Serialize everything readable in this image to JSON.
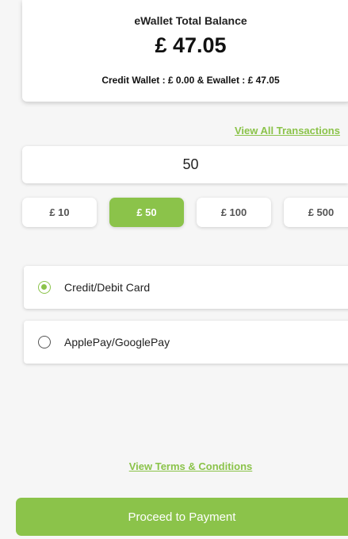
{
  "balance": {
    "title": "eWallet Total Balance",
    "amount": "£ 47.05",
    "breakdown": "Credit Wallet : £ 0.00 & Ewallet : £ 47.05"
  },
  "links": {
    "view_transactions": "View All Transactions",
    "terms": "View Terms & Conditions"
  },
  "amount_input": {
    "value": "50"
  },
  "presets": [
    {
      "label": "£ 10",
      "selected": false
    },
    {
      "label": "£ 50",
      "selected": true
    },
    {
      "label": "£ 100",
      "selected": false
    },
    {
      "label": "£ 500",
      "selected": false
    }
  ],
  "payment_methods": [
    {
      "label": "Credit/Debit Card",
      "selected": true
    },
    {
      "label": "ApplePay/GooglePay",
      "selected": false
    }
  ],
  "actions": {
    "proceed_label": "Proceed to Payment"
  },
  "colors": {
    "accent": "#8bc34a",
    "background": "#f6f6f6"
  }
}
